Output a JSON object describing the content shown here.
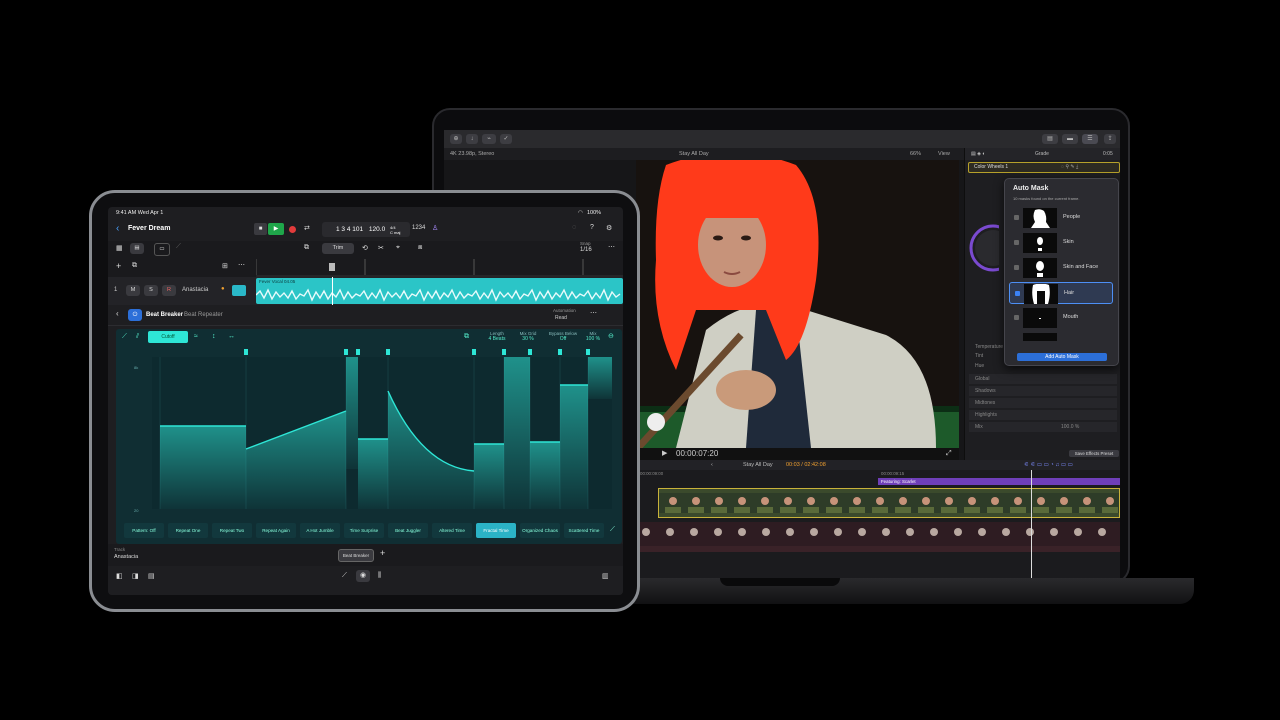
{
  "macbook": {
    "toolbar": {
      "bg_color": "#2a2a2d"
    },
    "info_bar": {
      "format": "4K 23.98p, Stereo",
      "clip_title": "Stay All Day",
      "zoom": "66%",
      "view_label": "View"
    },
    "inspector": {
      "tab_label": "Grade",
      "effect_name": "Color Wheels 1",
      "timecode": "0:05",
      "rows": [
        "Temperature",
        "Tint",
        "Hue",
        "Global",
        "Shadows",
        "Midtones",
        "Highlights",
        "Mix"
      ],
      "mix_value": "100.0 %"
    },
    "auto_mask": {
      "title": "Auto Mask",
      "subtitle": "10 masks found on the current frame.",
      "items": [
        {
          "label": "People",
          "checked": false,
          "selected": false
        },
        {
          "label": "Skin",
          "checked": false,
          "selected": false
        },
        {
          "label": "Skin and Face",
          "checked": false,
          "selected": false
        },
        {
          "label": "Hair",
          "checked": true,
          "selected": true
        },
        {
          "label": "Mouth",
          "checked": false,
          "selected": false
        }
      ],
      "add_button": "Add Auto Mask"
    },
    "viewer": {
      "timecode": "00:00:07:20"
    },
    "save_preset": "Save Effects Preset",
    "timeline": {
      "project": "Stay All Day",
      "position": "00:03 / 02:42:08",
      "ruler_time": "00:00:09:00",
      "ruler_time_2": "00:00:09:15",
      "title_clip": "Featuring: Scarlet",
      "title_clip_color": "#6f3fb8"
    }
  },
  "ipad": {
    "status": {
      "time": "9:41 AM  Wed Apr 1",
      "battery": "100%"
    },
    "project": {
      "title": "Fever Dream"
    },
    "transport": {
      "position": "1 3 4 101",
      "tempo": "120.0",
      "time_sig": "4/4",
      "key": "C maj",
      "count": "1234"
    },
    "snap": {
      "label": "Snap",
      "value": "1/16"
    },
    "trim_label": "Trim",
    "track": {
      "number": "1",
      "mute": "M",
      "solo": "S",
      "name": "Anastacia",
      "region": "Fever Vocal 04.05"
    },
    "plugin": {
      "name": "Beat Breaker",
      "preset": "Beat Repeater",
      "automation_label": "Automation",
      "automation_value": "Read"
    },
    "panel": {
      "cutoff_label": "Cutoff",
      "params": [
        {
          "label": "Length",
          "value": "4 Beats"
        },
        {
          "label": "Mix Grid",
          "value": "30 %"
        },
        {
          "label": "Bypass Below",
          "value": "Off"
        },
        {
          "label": "Mix",
          "value": "100 %"
        }
      ],
      "y_top": "8k",
      "y_bottom": "20",
      "patterns": [
        "Pattern: Off",
        "Repeat One",
        "Repeat Two",
        "Repeat Again",
        "A Hot Jumble",
        "Time Surprise",
        "Beat Juggler",
        "Altered Time",
        "Fractal Time",
        "Organized Chaos",
        "Scattered Time"
      ],
      "active_pattern": "Fractal Time"
    },
    "bottom": {
      "track_label": "Track",
      "track_name": "Anastacia",
      "chip": "Beat Breaker",
      "plus": "+"
    },
    "colors": {
      "accent": "#2ee6d6",
      "panel": "#102e33",
      "region": "#2bc5c7"
    }
  }
}
